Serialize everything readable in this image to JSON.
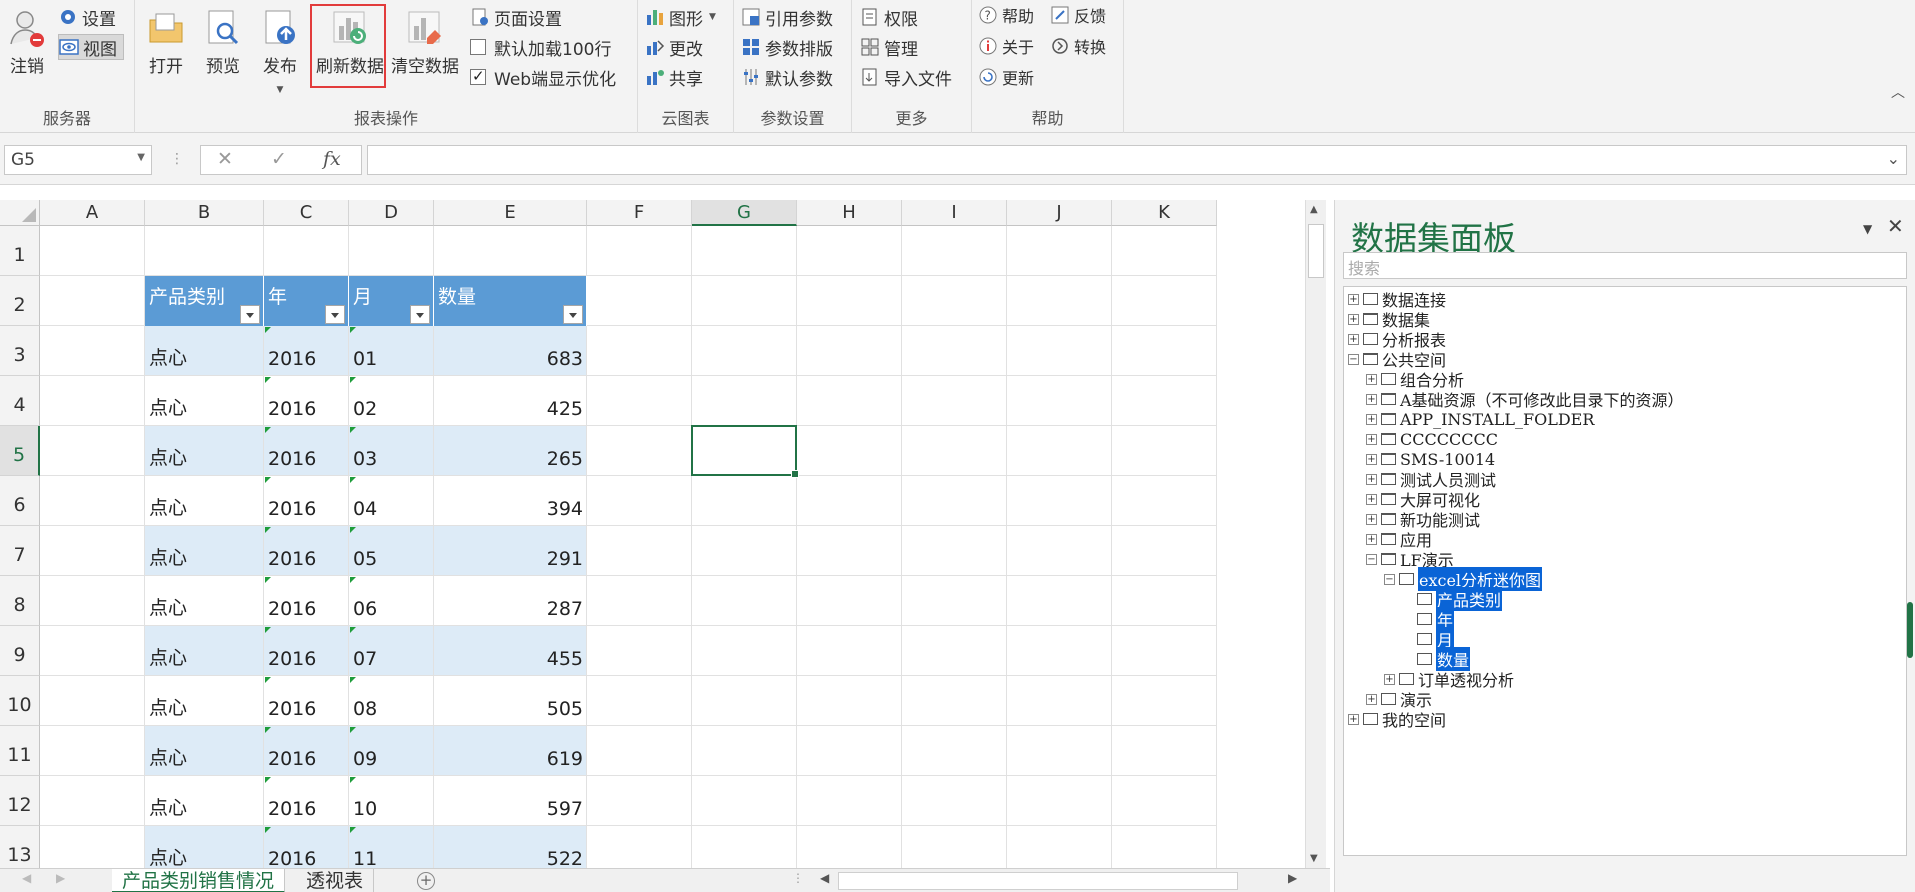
{
  "ribbon": {
    "server": {
      "logout": "注销",
      "settings": "设置",
      "view": "视图",
      "label": "服务器"
    },
    "report": {
      "open": "打开",
      "preview": "预览",
      "publish": "发布",
      "refresh": "刷新数据",
      "clear": "清空数据",
      "page_setup": "页面设置",
      "default_load": "默认加载100行",
      "web_opt": "Web端显示优化",
      "label": "报表操作",
      "default_load_checked": false,
      "web_opt_checked": true
    },
    "cloud": {
      "chart": "图形",
      "change": "更改",
      "share": "共享",
      "label": "云图表"
    },
    "params": {
      "ref": "引用参数",
      "layout": "参数排版",
      "default": "默认参数",
      "label": "参数设置"
    },
    "more": {
      "perm": "权限",
      "manage": "管理",
      "import": "导入文件",
      "label": "更多"
    },
    "help": {
      "help": "帮助",
      "feedback": "反馈",
      "about": "关于",
      "convert": "转换",
      "update": "更新",
      "label": "帮助"
    }
  },
  "formula": {
    "namebox": "G5",
    "cancel": "✕",
    "enter": "✓",
    "fx": "fx",
    "value": ""
  },
  "sheet": {
    "columns": [
      "A",
      "B",
      "C",
      "D",
      "E",
      "F",
      "G",
      "H",
      "I",
      "J",
      "K"
    ],
    "rows": [
      "1",
      "2",
      "3",
      "4",
      "5",
      "6",
      "7",
      "8",
      "9",
      "10",
      "11",
      "12",
      "13"
    ],
    "selected_col": "G",
    "selected_row": "5",
    "table_headers": [
      "产品类别",
      "年",
      "月",
      "数量"
    ],
    "table_rows": [
      [
        "点心",
        "2016",
        "01",
        "683"
      ],
      [
        "点心",
        "2016",
        "02",
        "425"
      ],
      [
        "点心",
        "2016",
        "03",
        "265"
      ],
      [
        "点心",
        "2016",
        "04",
        "394"
      ],
      [
        "点心",
        "2016",
        "05",
        "291"
      ],
      [
        "点心",
        "2016",
        "06",
        "287"
      ],
      [
        "点心",
        "2016",
        "07",
        "455"
      ],
      [
        "点心",
        "2016",
        "08",
        "505"
      ],
      [
        "点心",
        "2016",
        "09",
        "619"
      ],
      [
        "点心",
        "2016",
        "10",
        "597"
      ],
      [
        "点心",
        "2016",
        "11",
        "522"
      ]
    ]
  },
  "tabs": {
    "items": [
      "产品类别销售情况",
      "透视表"
    ],
    "active": 0,
    "add": "+"
  },
  "panel": {
    "title": "数据集面板",
    "search_placeholder": "搜索",
    "tree": [
      {
        "label": "数据连接",
        "level": 0,
        "exp": "+",
        "icon": "db"
      },
      {
        "label": "数据集",
        "level": 0,
        "exp": "+",
        "icon": "folder"
      },
      {
        "label": "分析报表",
        "level": 0,
        "exp": "+",
        "icon": "chart"
      },
      {
        "label": "公共空间",
        "level": 0,
        "exp": "-",
        "icon": "folder"
      },
      {
        "label": "组合分析",
        "level": 1,
        "exp": "+",
        "icon": "combo"
      },
      {
        "label": "A基础资源（不可修改此目录下的资源）",
        "level": 1,
        "exp": "+",
        "icon": "folder"
      },
      {
        "label": "APP_INSTALL_FOLDER",
        "level": 1,
        "exp": "+",
        "icon": "folder"
      },
      {
        "label": "CCCCCCCC",
        "level": 1,
        "exp": "+",
        "icon": "folder"
      },
      {
        "label": "SMS-10014",
        "level": 1,
        "exp": "+",
        "icon": "folder"
      },
      {
        "label": "测试人员测试",
        "level": 1,
        "exp": "+",
        "icon": "folder"
      },
      {
        "label": "大屏可视化",
        "level": 1,
        "exp": "+",
        "icon": "folder"
      },
      {
        "label": "新功能测试",
        "level": 1,
        "exp": "+",
        "icon": "folder"
      },
      {
        "label": "应用",
        "level": 1,
        "exp": "+",
        "icon": "folder"
      },
      {
        "label": "LF演示",
        "level": 1,
        "exp": "-",
        "icon": "folder"
      },
      {
        "label": "excel分析迷你图",
        "level": 2,
        "exp": "-",
        "icon": "report",
        "sel": true
      },
      {
        "label": "产品类别",
        "level": 3,
        "exp": "",
        "icon": "field",
        "sel": true
      },
      {
        "label": "年",
        "level": 3,
        "exp": "",
        "icon": "field",
        "sel": true
      },
      {
        "label": "月",
        "level": 3,
        "exp": "",
        "icon": "field",
        "sel": true
      },
      {
        "label": "数量",
        "level": 3,
        "exp": "",
        "icon": "field",
        "sel": true
      },
      {
        "label": "订单透视分析",
        "level": 2,
        "exp": "+",
        "icon": "report"
      },
      {
        "label": "演示",
        "level": 1,
        "exp": "+",
        "icon": "report"
      },
      {
        "label": "我的空间",
        "level": 0,
        "exp": "+",
        "icon": "user"
      }
    ]
  },
  "colors": {
    "accent": "#217346",
    "table_header": "#5b9bd5",
    "band": "#ddebf7",
    "highlight": "#e23b3b",
    "tree_sel": "#0a64d6"
  }
}
